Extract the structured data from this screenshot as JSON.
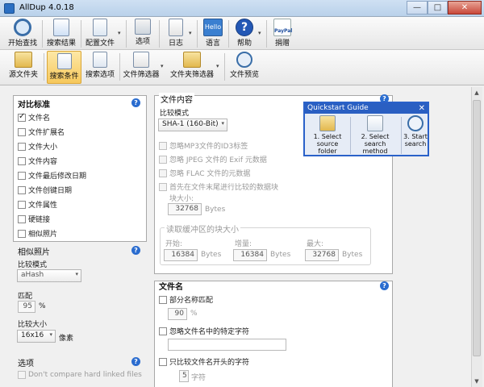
{
  "window": {
    "title": "AllDup 4.0.18",
    "min": "—",
    "max": "□",
    "close": "✕"
  },
  "toolbar_main": [
    {
      "label": "开始查找",
      "icon": "magnifier-icon"
    },
    {
      "label": "搜索结果",
      "icon": "results-icon"
    },
    {
      "label": "配置文件",
      "icon": "profile-icon"
    },
    {
      "label": "选项",
      "icon": "options-icon"
    },
    {
      "label": "日志",
      "icon": "log-icon"
    },
    {
      "label": "语言",
      "icon": "language-icon",
      "badge": "Hello"
    },
    {
      "label": "帮助",
      "icon": "help-icon"
    },
    {
      "label": "捐赠",
      "icon": "donate-icon",
      "badge": "PayPal"
    }
  ],
  "toolbar_sub": [
    {
      "label": "源文件夹"
    },
    {
      "label": "搜索条件"
    },
    {
      "label": "搜索选项"
    },
    {
      "label": "文件筛选器"
    },
    {
      "label": "文件夹筛选器"
    },
    {
      "label": "文件预览"
    }
  ],
  "compare": {
    "title": "对比标准",
    "items": [
      {
        "label": "文件名",
        "checked": true
      },
      {
        "label": "文件扩展名",
        "checked": false
      },
      {
        "label": "文件大小",
        "checked": false
      },
      {
        "label": "文件内容",
        "checked": false
      },
      {
        "label": "文件最后修改日期",
        "checked": false
      },
      {
        "label": "文件创键日期",
        "checked": false
      },
      {
        "label": "文件属性",
        "checked": false
      },
      {
        "label": "硬链接",
        "checked": false
      },
      {
        "label": "相似照片",
        "checked": false
      }
    ]
  },
  "photos": {
    "title": "相似照片",
    "mode_label": "比较模式",
    "mode_value": "aHash",
    "match_label": "匹配",
    "match_value": "95",
    "match_unit": "%",
    "size_label": "比较大小",
    "size_value": "16x16",
    "size_unit": "像素"
  },
  "options": {
    "title": "选项",
    "hardlink": "Don't compare hard linked files"
  },
  "content": {
    "title": "文件内容",
    "mode_label": "比较模式",
    "mode_value": "SHA-1 (160-Bit)",
    "ignore_mp3": "忽略MP3文件的ID3标签",
    "ignore_jpeg": "忽略 JPEG 文件的 Exif 元数据",
    "ignore_flac": "忽略 FLAC 文件的元数据",
    "end_first": "首先在文件末尾进行比较的数据块",
    "block_label": "块大小:",
    "block_value": "32768",
    "bytes": "Bytes",
    "buffer_title": "读取缓冲区的块大小",
    "start_label": "开始:",
    "start_value": "16384",
    "inc_label": "增量:",
    "inc_value": "16384",
    "max_label": "最大:",
    "max_value": "32768"
  },
  "filename": {
    "title": "文件名",
    "partial": "部分名称匹配",
    "partial_value": "90",
    "partial_unit": "%",
    "ignore_chars": "忽略文件名中的特定字符",
    "ignore_chars_value": "",
    "compare_start": "只比较文件名开头的字符",
    "compare_start_value": "5",
    "compare_start_unit": "字符"
  },
  "quickstart": {
    "title": "Quickstart Guide",
    "close": "✕",
    "steps": [
      {
        "line1": "1. Select",
        "line2": "source folder"
      },
      {
        "line1": "2. Select",
        "line2": "search method"
      },
      {
        "line1": "3. Start",
        "line2": "search"
      }
    ]
  },
  "help_glyph": "?",
  "colors": {
    "accent": "#2a6ccf",
    "active_tab": "#f6c85c",
    "qs_border": "#2a61c9"
  }
}
